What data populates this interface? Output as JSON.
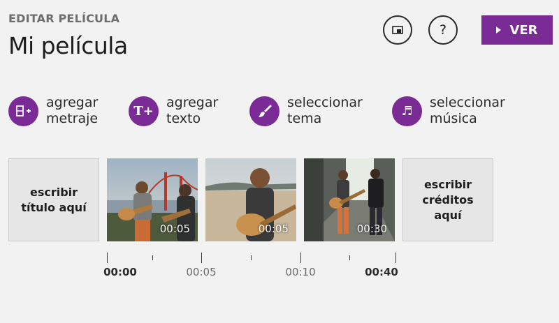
{
  "header": {
    "kicker": "EDITAR PELÍCULA",
    "title": "Mi película"
  },
  "toolbar": {
    "help_label": "?",
    "ver_label": "VER"
  },
  "actions": [
    {
      "label": "agregar\nmetraje",
      "icon": "add-footage-icon"
    },
    {
      "label": "agregar\ntexto",
      "icon": "add-text-icon",
      "glyph": "T+"
    },
    {
      "label": "seleccionar\ntema",
      "icon": "paintbrush-icon"
    },
    {
      "label": "seleccionar\nmúsica",
      "icon": "music-note-icon",
      "glyph": "♬"
    }
  ],
  "timeline": {
    "title_card": "escribir\ntítulo aquí",
    "credits_card": "escribir\ncréditos\naquí",
    "clips": [
      {
        "duration": "00:05"
      },
      {
        "duration": "00:05"
      },
      {
        "duration": "00:30"
      }
    ],
    "ruler": [
      "00:00",
      "00:05",
      "00:10",
      "00:40"
    ]
  },
  "colors": {
    "accent": "#7b2b96",
    "background": "#f2f2f2"
  }
}
